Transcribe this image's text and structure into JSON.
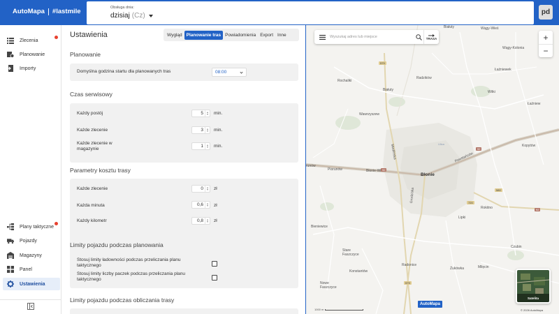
{
  "topbar": {
    "logo": "AutoMapa",
    "tagline": "#lastmile",
    "day_label": "Obsługa dnia:",
    "day_value": "dzisiaj",
    "day_weekday": "(Cz)",
    "avatar_initials": "pd"
  },
  "sidebar": {
    "items_top": [
      {
        "label": "Zlecenia",
        "icon": "list-icon",
        "badge": true
      },
      {
        "label": "Planowanie",
        "icon": "planning-icon",
        "badge": false
      },
      {
        "label": "Importy",
        "icon": "import-icon",
        "badge": false
      }
    ],
    "items_bottom": [
      {
        "label": "Plany taktyczne",
        "icon": "tactical-plans-icon",
        "badge": true
      },
      {
        "label": "Pojazdy",
        "icon": "truck-icon",
        "badge": false
      },
      {
        "label": "Magazyny",
        "icon": "warehouse-icon",
        "badge": false
      },
      {
        "label": "Panel",
        "icon": "dashboard-icon",
        "badge": false
      },
      {
        "label": "Ustawienia",
        "icon": "gear-icon",
        "badge": false,
        "active": true
      }
    ]
  },
  "settings": {
    "title": "Ustawienia",
    "tabs": [
      "Wygląd",
      "Planowanie tras",
      "Powiadomienia",
      "Export",
      "Inne"
    ],
    "active_tab": "Planowanie tras",
    "planning": {
      "section": "Planowanie",
      "start_label": "Domyślna godzina startu dla planowanych tras",
      "start_value": "08:00"
    },
    "service": {
      "section": "Czas serwisowy",
      "rows": [
        {
          "label": "Każdy postój",
          "value": "5",
          "unit": "min."
        },
        {
          "label": "Każde zlecenie",
          "value": "3",
          "unit": "min."
        },
        {
          "label": "Każde zlecenie w magazynie",
          "value": "1",
          "unit": "min."
        }
      ]
    },
    "cost": {
      "section": "Parametry kosztu trasy",
      "rows": [
        {
          "label": "Każde zlecenie",
          "value": "0",
          "unit": "zł"
        },
        {
          "label": "Każda minuta",
          "value": "0,6",
          "unit": "zł"
        },
        {
          "label": "Każdy kilometr",
          "value": "0,8",
          "unit": "zł"
        }
      ]
    },
    "limits": {
      "section": "Limity pojazdu podczas planowania",
      "rows": [
        {
          "label": "Stosuj limity ładowności podczas przeliczania planu taktycznego",
          "checked": false
        },
        {
          "label": "Stosuj limity liczby paczek podczas przeliczania planu taktycznego",
          "checked": false
        }
      ]
    },
    "limits2": {
      "section": "Limity pojazdu podczas obliczania trasy"
    }
  },
  "map": {
    "search_placeholder": "Wyszukaj adres lub miejsce",
    "route_button": "TRASA",
    "zoom_in": "+",
    "zoom_out": "−",
    "satellite_label": "Satelita",
    "logo": "AutoMapa",
    "scale_label": "1000 m",
    "copyright": "© 2026 AutoMapa",
    "places": {
      "blonie": "Błonie",
      "rochaliki": "Rochaliki",
      "bialuty": "Białuty",
      "radzikow": "Radzików",
      "wawrzyszew": "Wawrzyszew",
      "piorunow": "Piorunów",
      "blonie_wies": "Błonie-Wieś",
      "bieniewice": "Bieniewice",
      "stare_faszczyce": "Stare Faszczyce",
      "konstantow": "Konstantów",
      "radonice": "Radonice",
      "nowe_faszczyce": "Nowe Faszczyce",
      "zukowka": "Żukówka",
      "milecin": "Milęcin",
      "bialuty_n": "Białuty",
      "wajgy_wies": "Wągy-Wieś",
      "wajgy_kolonia": "Wągy-Kolonia",
      "lazniewek": "Łaźniewek",
      "witki": "Witki",
      "lazniew": "Łaźniew",
      "kopytow": "Kopytów",
      "rokitno": "Rokitno",
      "lipki": "Lipki",
      "czubin": "Czubin",
      "modlinska": "Modlińska",
      "grodziska": "Grodziska",
      "powstancow": "Powstańców",
      "runow": "runów",
      "ulica": "Ulica"
    },
    "road_badges": {
      "r579a": "579",
      "r579b": "579",
      "r92a": "92",
      "r92b": "92",
      "r720": "720",
      "r580": "580",
      "r92c": "92"
    }
  }
}
